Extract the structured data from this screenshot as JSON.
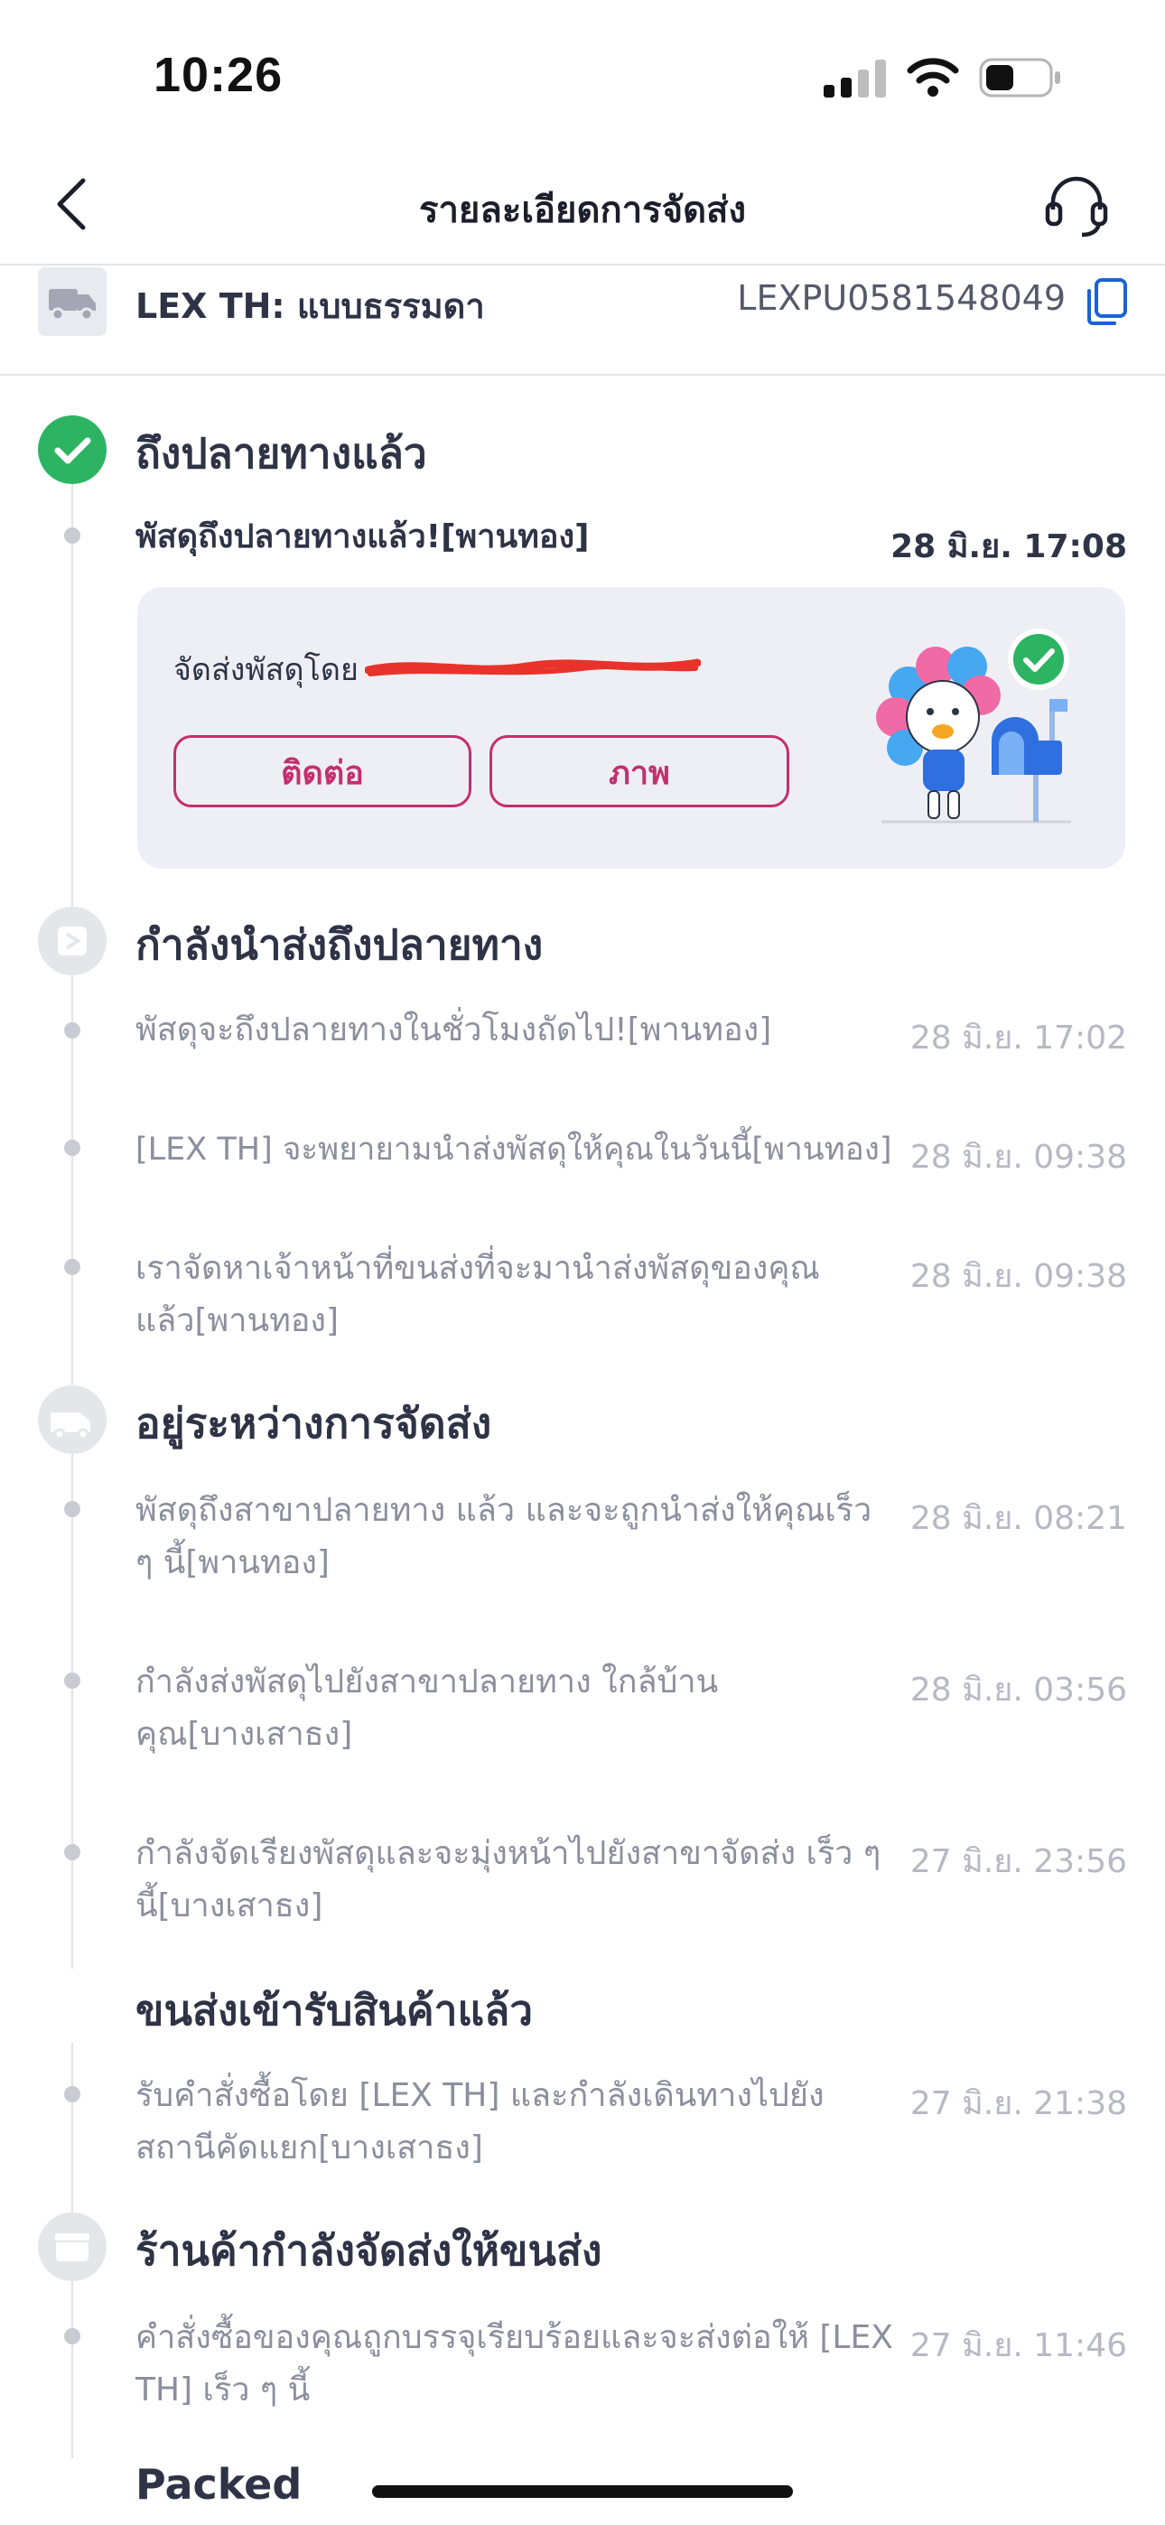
{
  "status_bar": {
    "time": "10:26"
  },
  "nav": {
    "title": "รายละเอียดการจัดส่ง"
  },
  "carrier": {
    "name": "LEX TH: แบบธรรมดา",
    "tracking_number": "LEXPU0581548049"
  },
  "sections": [
    {
      "title": "ถึงปลายทางแล้ว",
      "events": [
        {
          "text": "พัสดุถึงปลายทางแล้ว![พานทอง]",
          "time": "28 มิ.ย. 17:08"
        }
      ],
      "card": {
        "delivered_by_label": "จัดส่งพัสดุโดย",
        "contact_button": "ติดต่อ",
        "photo_button": "ภาพ"
      }
    },
    {
      "title": "กำลังนำส่งถึงปลายทาง",
      "events": [
        {
          "text": "พัสดุจะถึงปลายทางในชั่วโมงถัดไป![พานทอง]",
          "time": "28 มิ.ย. 17:02"
        },
        {
          "text": "[LEX TH] จะพยายามนำส่งพัสดุให้คุณในวันนี้[พานทอง]",
          "time": "28 มิ.ย. 09:38"
        },
        {
          "text": "เราจัดหาเจ้าหน้าที่ขนส่งที่จะมานำส่งพัสดุของคุณแล้ว[พานทอง]",
          "time": "28 มิ.ย. 09:38"
        }
      ]
    },
    {
      "title": "อยู่ระหว่างการจัดส่ง",
      "events": [
        {
          "text": "พัสดุถึงสาขาปลายทาง แล้ว และจะถูกนำส่งให้คุณเร็ว ๆ นี้[พานทอง]",
          "time": "28 มิ.ย. 08:21"
        },
        {
          "text": "กำลังส่งพัสดุไปยังสาขาปลายทาง ใกล้บ้านคุณ[บางเสาธง]",
          "time": "28 มิ.ย. 03:56"
        },
        {
          "text": "กำลังจัดเรียงพัสดุและจะมุ่งหน้าไปยังสาขาจัดส่ง เร็ว ๆ นี้[บางเสาธง]",
          "time": "27 มิ.ย. 23:56"
        }
      ]
    },
    {
      "title": "ขนส่งเข้ารับสินค้าแล้ว",
      "events": [
        {
          "text": "รับคำสั่งซื้อโดย [LEX TH] และกำลังเดินทางไปยังสถานีคัดแยก[บางเสาธง]",
          "time": "27 มิ.ย. 21:38"
        }
      ]
    },
    {
      "title": "ร้านค้ากำลังจัดส่งให้ขนส่ง",
      "events": [
        {
          "text": "คำสั่งซื้อของคุณถูกบรรจุเรียบร้อยและจะส่งต่อให้ [LEX TH] เร็ว ๆ นี้",
          "time": "27 มิ.ย. 11:46"
        }
      ]
    },
    {
      "title": "Packed",
      "events": []
    }
  ],
  "colors": {
    "success": "#2cb463",
    "accent": "#c42f6f",
    "card_bg": "#eeeff4"
  },
  "icons": [
    "signal-icon",
    "wifi-icon",
    "battery-icon",
    "back-arrow-icon",
    "headset-icon",
    "truck-icon",
    "copy-icon",
    "check-circle-icon",
    "package-delivery-icon",
    "van-icon",
    "box-icon",
    "mascot-mailbox-illustration"
  ]
}
